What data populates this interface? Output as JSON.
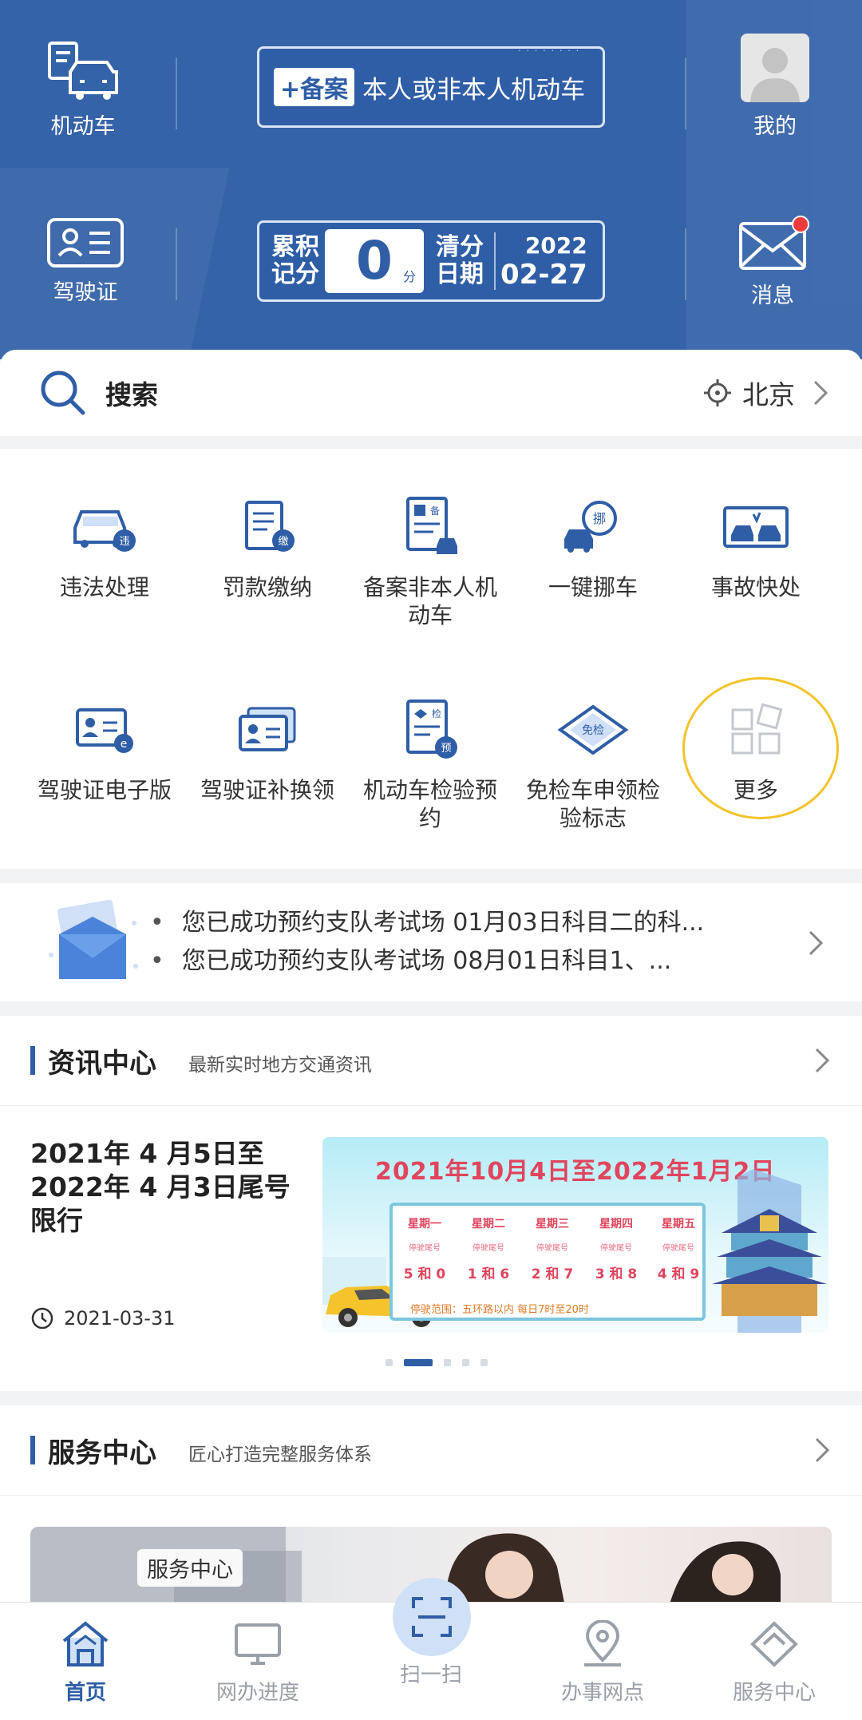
{
  "header": {
    "vehicle_label": "机动车",
    "license_label": "驾驶证",
    "mine_label": "我的",
    "message_label": "消息",
    "plate_tag": "+备案",
    "plate_text": "本人或非本人机动车",
    "score_label_line1": "累积",
    "score_label_line2": "记分",
    "score_value": "0",
    "score_unit": "分",
    "clear_label_line1": "清分",
    "clear_label_line2": "日期",
    "clear_year": "2022",
    "clear_date": "02-27",
    "accent_color": "#3563a8",
    "badge_color": "#ee3b3b"
  },
  "search": {
    "label": "搜索",
    "city": "北京"
  },
  "services": [
    {
      "label": "违法处理",
      "icon": "car-violation-icon"
    },
    {
      "label": "罚款缴纳",
      "icon": "fine-payment-icon"
    },
    {
      "label": "备案非本人机动车",
      "icon": "register-vehicle-icon"
    },
    {
      "label": "一键挪车",
      "icon": "move-car-icon"
    },
    {
      "label": "事故快处",
      "icon": "accident-icon"
    },
    {
      "label": "驾驶证电子版",
      "icon": "e-license-icon"
    },
    {
      "label": "驾驶证补换领",
      "icon": "license-replace-icon"
    },
    {
      "label": "机动车检验预约",
      "icon": "inspection-appointment-icon"
    },
    {
      "label": "免检车申领检验标志",
      "icon": "exempt-sticker-icon"
    },
    {
      "label": "更多",
      "icon": "more-grid-icon"
    }
  ],
  "notices": [
    "您已成功预约支队考试场 01月03日科目二的科...",
    "您已成功预约支队考试场 08月01日科目1、..."
  ],
  "news_section": {
    "title": "资讯中心",
    "subtitle": "最新实时地方交通资讯",
    "article_title": "2021年 4 月5日至2022年 4 月3日尾号限行",
    "article_date": "2021-03-31",
    "banner": {
      "title": "2021年10月4日至2022年1月2日",
      "days": [
        {
          "day": "星期一",
          "note": "停驶尾号",
          "nums": "5 和 0"
        },
        {
          "day": "星期二",
          "note": "停驶尾号",
          "nums": "1 和 6"
        },
        {
          "day": "星期三",
          "note": "停驶尾号",
          "nums": "2 和 7"
        },
        {
          "day": "星期四",
          "note": "停驶尾号",
          "nums": "3 和 8"
        },
        {
          "day": "星期五",
          "note": "停驶尾号",
          "nums": "4 和 9"
        }
      ],
      "range_note": "停驶范围：五环路以内    每日7时至20时"
    },
    "carousel_active": 1,
    "carousel_count": 5
  },
  "service_section": {
    "title": "服务中心",
    "subtitle": "匠心打造完整服务体系",
    "image_tag": "服务中心"
  },
  "bottom_nav": [
    {
      "label": "首页",
      "icon": "home-icon",
      "active": true
    },
    {
      "label": "网办进度",
      "icon": "monitor-icon",
      "active": false
    },
    {
      "label": "扫一扫",
      "icon": "scan-icon",
      "active": false
    },
    {
      "label": "办事网点",
      "icon": "location-pin-icon",
      "active": false
    },
    {
      "label": "服务中心",
      "icon": "service-diamond-icon",
      "active": false
    }
  ]
}
